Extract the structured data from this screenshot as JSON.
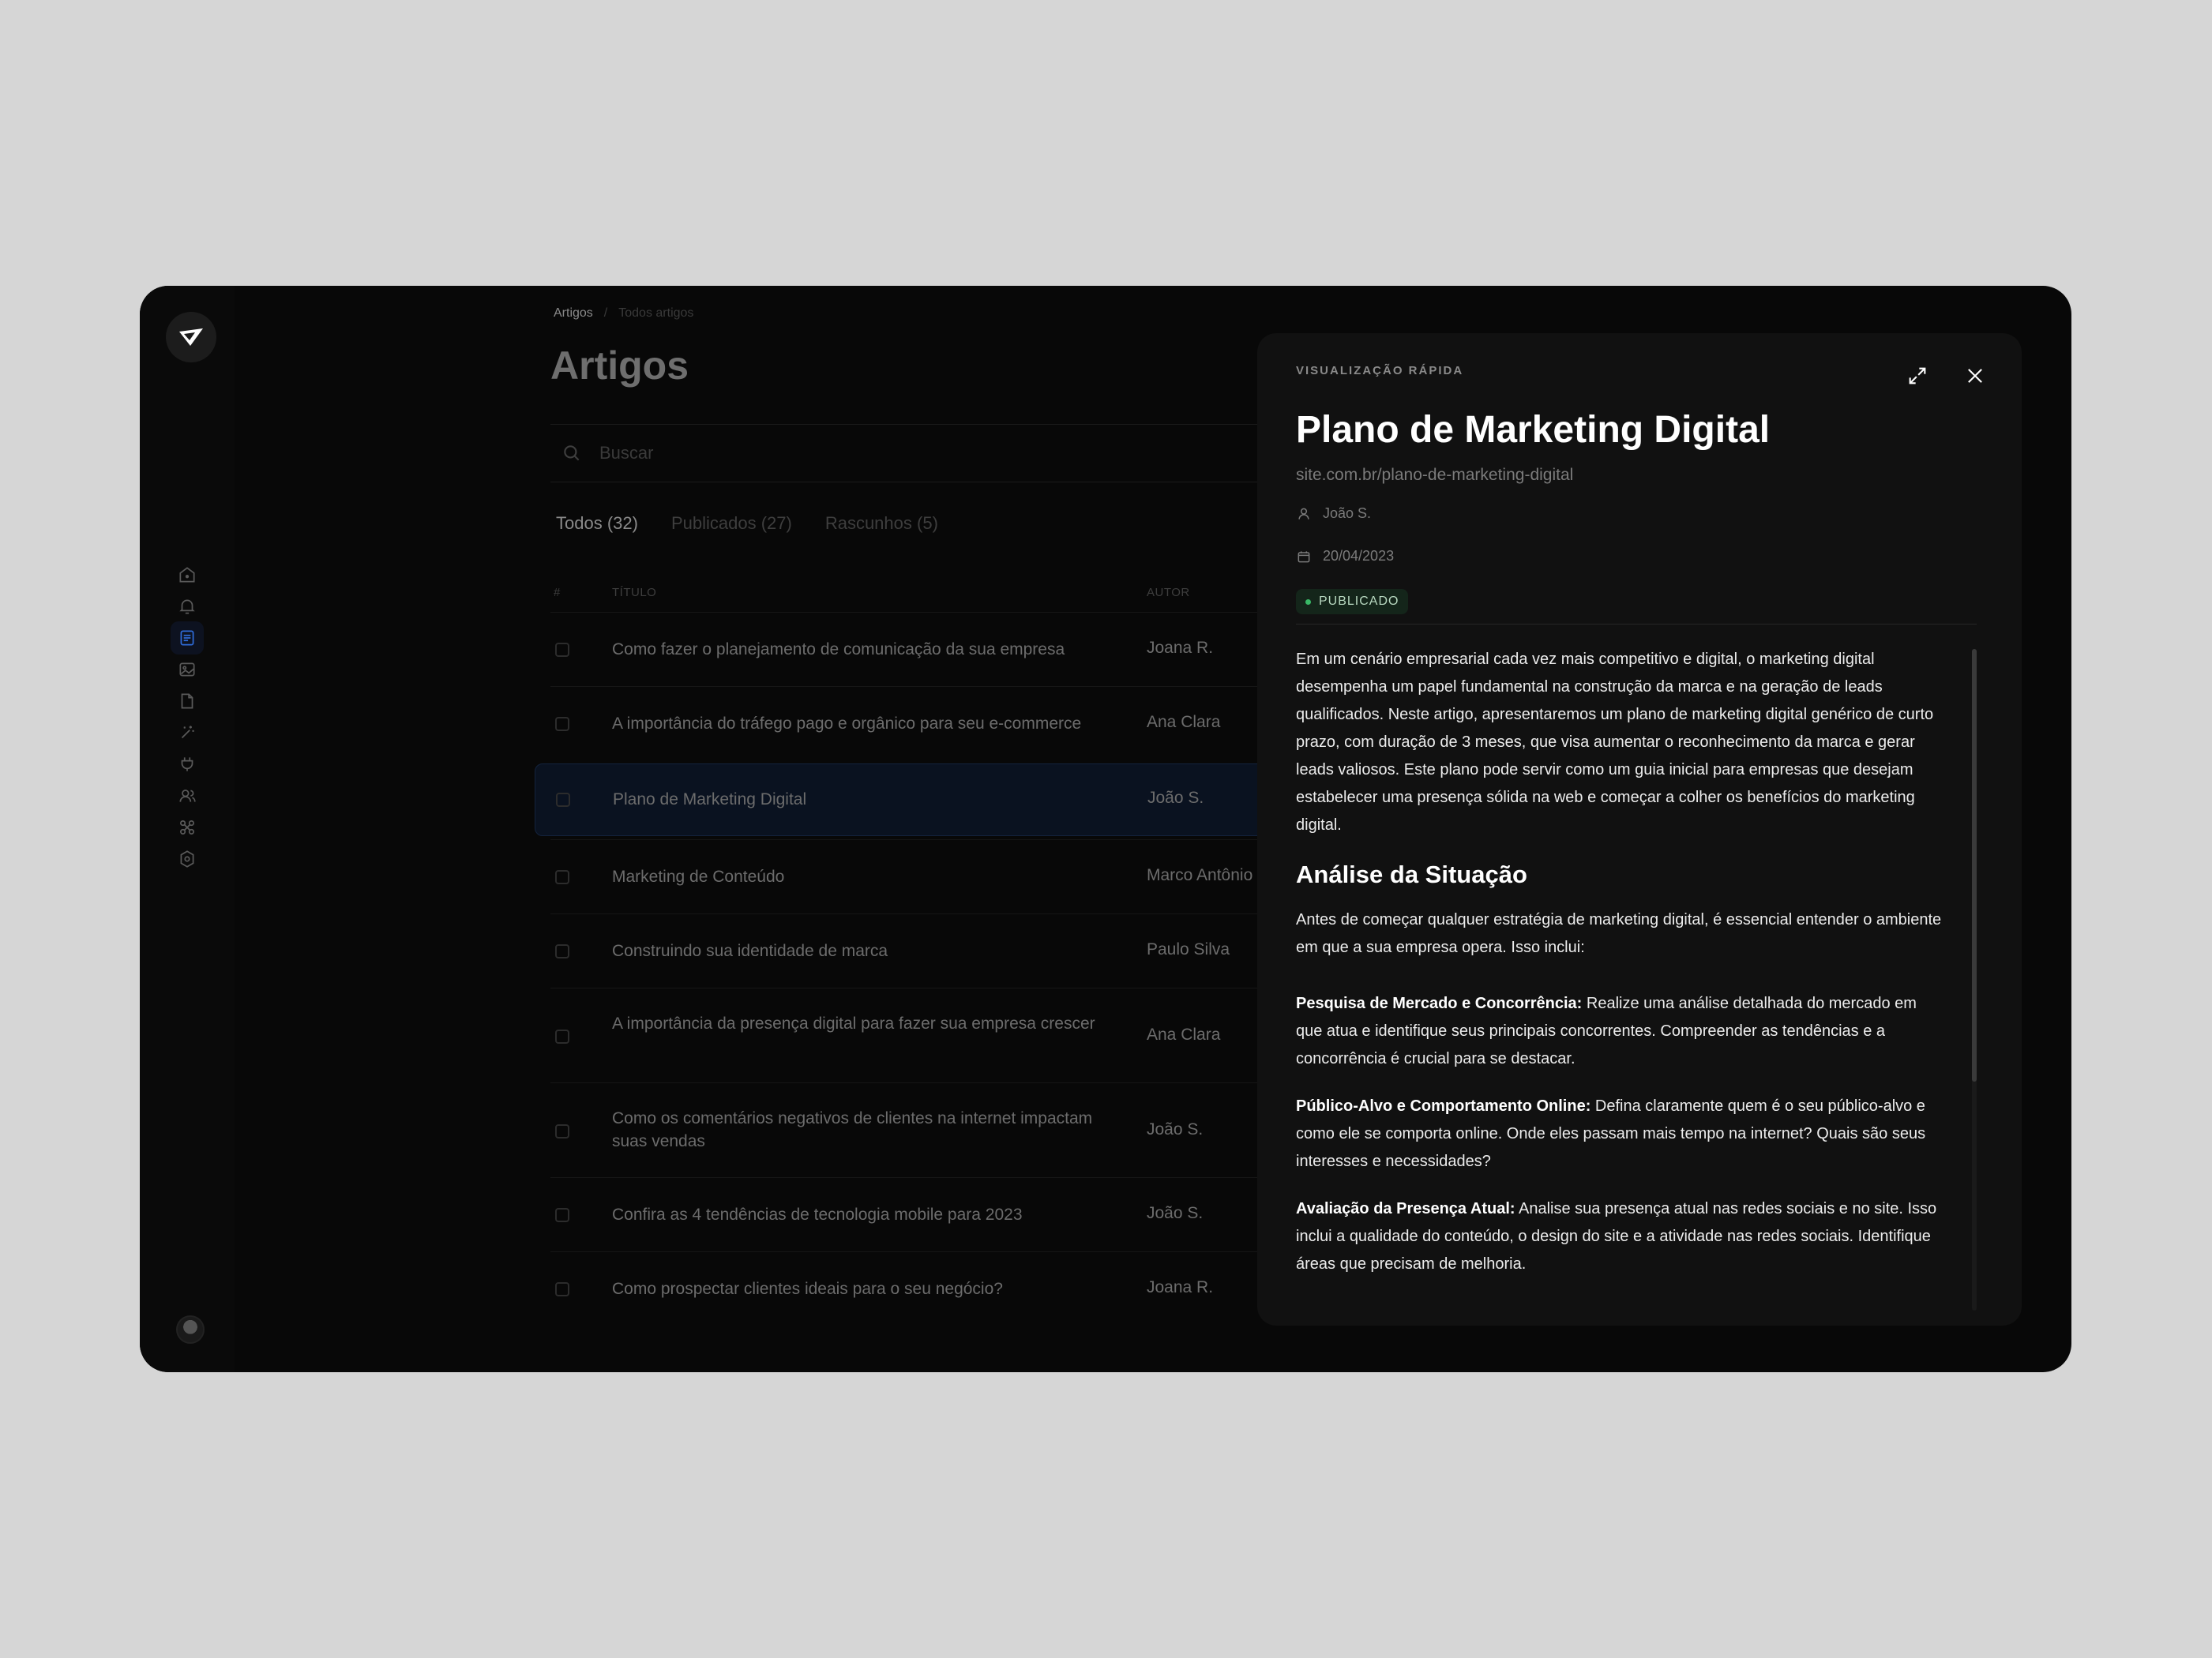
{
  "breadcrumb": {
    "root": "Artigos",
    "sep": "/",
    "current": "Todos artigos"
  },
  "page": {
    "title": "Artigos"
  },
  "search": {
    "placeholder": "Buscar"
  },
  "tabs": [
    {
      "label": "Todos (32)"
    },
    {
      "label": "Publicados (27)"
    },
    {
      "label": "Rascunhos (5)"
    }
  ],
  "table": {
    "headers": {
      "index": "#",
      "title": "TÍTULO",
      "author": "AUTOR"
    },
    "rows": [
      {
        "title": "Como fazer o planejamento de comunicação da sua empresa",
        "author": "Joana R."
      },
      {
        "title": "A importância do tráfego pago e orgânico para seu e-commerce",
        "author": "Ana Clara"
      },
      {
        "title": "Plano de Marketing Digital",
        "author": "João S."
      },
      {
        "title": "Marketing de Conteúdo",
        "author": "Marco Antônio"
      },
      {
        "title": "Construindo sua identidade de marca",
        "author": "Paulo Silva"
      },
      {
        "title": "A importância da presença digital para fazer sua empresa crescer",
        "author": "Ana Clara"
      },
      {
        "title": "Como os comentários negativos de clientes na internet impactam suas vendas",
        "author": "João S."
      },
      {
        "title": "Confira as 4 tendências de tecnologia mobile para 2023",
        "author": "João S."
      },
      {
        "title": "Como prospectar clientes ideais para o seu negócio?",
        "author": "Joana R."
      }
    ]
  },
  "quick_view": {
    "eyebrow": "VISUALIZAÇÃO RÁPIDA",
    "title": "Plano de Marketing Digital",
    "slug": "site.com.br/plano-de-marketing-digital",
    "author": "João S.",
    "date": "20/04/2023",
    "status": "PUBLICADO",
    "status_color": "#39b866",
    "intro": "Em um cenário empresarial cada vez mais competitivo e digital, o marketing digital desempenha um papel fundamental na construção da marca e na geração de leads qualificados. Neste artigo, apresentaremos um plano de marketing digital genérico de curto prazo, com duração de 3 meses, que visa aumentar o reconhecimento da marca e gerar leads valiosos. Este plano pode servir como um guia inicial para empresas que desejam estabelecer uma presença sólida na web e começar a colher os benefícios do marketing digital.",
    "section_title": "Análise da Situação",
    "section_intro": "Antes de começar qualquer estratégia de marketing digital, é essencial entender o ambiente em que a sua empresa opera. Isso inclui:",
    "items": [
      {
        "label": "Pesquisa de Mercado e Concorrência:",
        "text": " Realize uma análise detalhada do mercado em que atua e identifique seus principais concorrentes. Compreender as tendências e a concorrência é crucial para se destacar."
      },
      {
        "label": "Público-Alvo e Comportamento Online:",
        "text": " Defina claramente quem é o seu público-alvo e como ele se comporta online. Onde eles passam mais tempo na internet? Quais são seus interesses e necessidades?"
      },
      {
        "label": "Avaliação da Presença Atual:",
        "text": " Analise sua presença atual nas redes sociais e no site. Isso inclui a qualidade do conteúdo, o design do site e a atividade nas redes sociais. Identifique áreas que precisam de melhoria."
      }
    ]
  },
  "sidebar_icons": [
    "home-icon",
    "bell-icon",
    "article-icon",
    "image-icon",
    "file-icon",
    "magic-wand-icon",
    "plug-icon",
    "users-icon",
    "integrations-icon",
    "settings-icon"
  ],
  "colors": {
    "accent": "#2f6bd8",
    "background": "#080808",
    "panel": "#111111"
  }
}
